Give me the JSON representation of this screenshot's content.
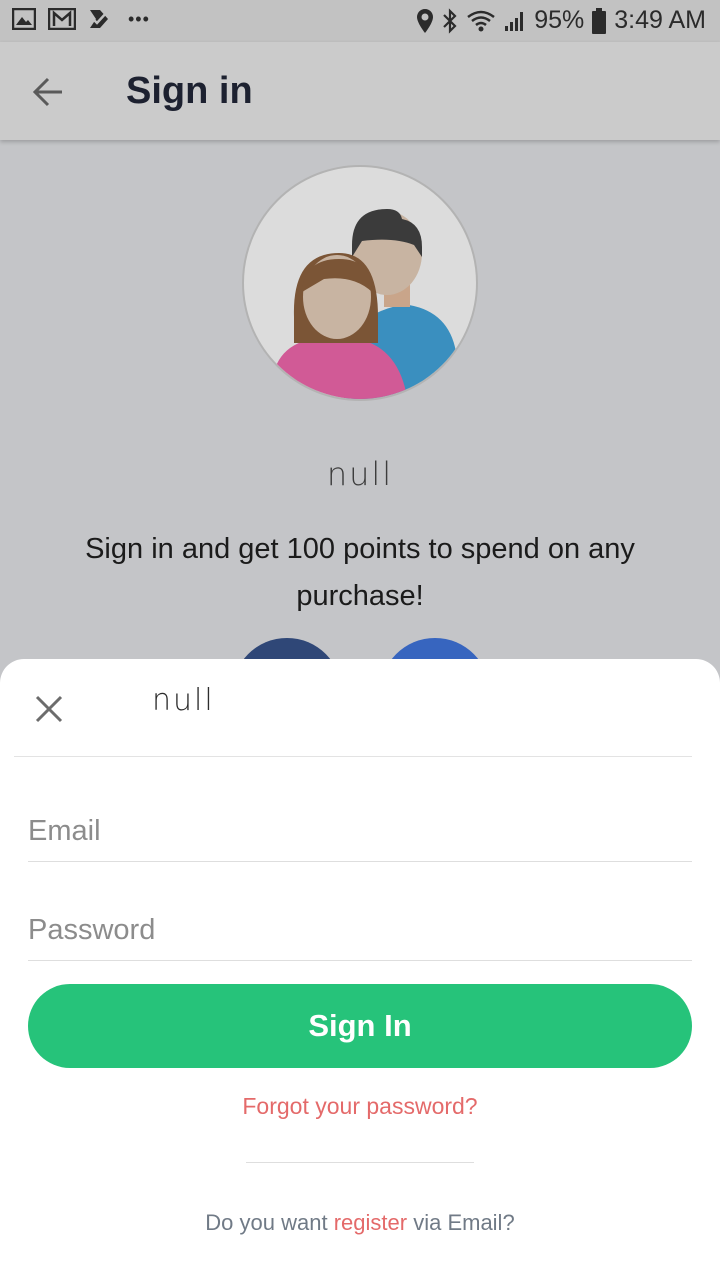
{
  "status_bar": {
    "battery": "95%",
    "time": "3:49 AM",
    "notification_icons": [
      "image-icon",
      "gmail-icon",
      "tasks-icon",
      "more-dots-icon"
    ],
    "system_icons": [
      "location-icon",
      "bluetooth-icon",
      "wifi-icon",
      "signal-icon",
      "battery-icon"
    ],
    "more_text": "•••"
  },
  "app_bar": {
    "title": "Sign in",
    "back_icon": "arrow-left-icon"
  },
  "background": {
    "name": "null",
    "promo": "Sign in and get 100 points to spend on any purchase!",
    "avatar_icon": "couple-avatar-icon",
    "social_buttons": [
      "facebook-button",
      "google-button"
    ]
  },
  "sheet": {
    "title": "null",
    "close_icon": "close-icon",
    "email_placeholder": "Email",
    "password_placeholder": "Password",
    "signin_label": "Sign In",
    "forgot_label": "Forgot your password?",
    "register_prefix": "Do you want",
    "register_link": "register",
    "register_suffix": "via Email?"
  },
  "colors": {
    "accent": "#26c37a",
    "link": "#e46a6a",
    "facebook": "#2f4777",
    "google": "#3765bf"
  }
}
